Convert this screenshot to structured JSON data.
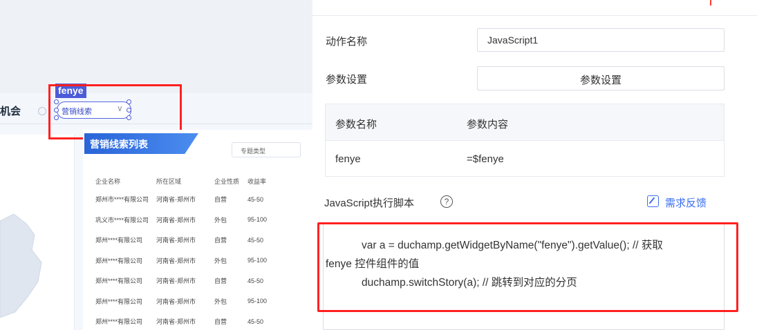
{
  "canvas": {
    "nav_tab": "机会",
    "widget_tag": "fenye",
    "widget_select_value": "营销线索",
    "list": {
      "title": "营销线索列表",
      "filter_placeholder": "专题类型",
      "columns": [
        "企业名称",
        "所在区域",
        "企业性质",
        "收益率"
      ],
      "rows": [
        [
          "郑州市****有限公司",
          "河南省-郑州市",
          "自营",
          "45-50"
        ],
        [
          "巩义市****有限公司",
          "河南省-郑州市",
          "外包",
          "95-100"
        ],
        [
          "郑州****有限公司",
          "河南省-郑州市",
          "自营",
          "45-50"
        ],
        [
          "郑州****有限公司",
          "河南省-郑州市",
          "外包",
          "95-100"
        ],
        [
          "郑州****有限公司",
          "河南省-郑州市",
          "自营",
          "45-50"
        ],
        [
          "郑州****有限公司",
          "河南省-郑州市",
          "外包",
          "95-100"
        ],
        [
          "郑州****有限公司",
          "河南省-郑州市",
          "自营",
          "45-50"
        ]
      ]
    }
  },
  "panel": {
    "action_name_label": "动作名称",
    "action_name_value": "JavaScript1",
    "param_settings_label": "参数设置",
    "param_settings_button": "参数设置",
    "param_table": {
      "head_name": "参数名称",
      "head_value": "参数内容",
      "row_name": "fenye",
      "row_value": "=$fenye"
    },
    "script_label": "JavaScript执行脚本",
    "help_glyph": "?",
    "feedback": "需求反馈",
    "code": {
      "line1": "var a = duchamp.getWidgetByName(\"fenye\").getValue(); // 获取",
      "line2": "fenye 控件组件的值",
      "line3": "duchamp.switchStory(a); // 跳转到对应的分页"
    }
  },
  "colors": {
    "accent": "#4b5bd8",
    "highlight_red": "#ff2020",
    "link_blue": "#3a6ff0",
    "list_title_blue": "#2a64d8"
  }
}
